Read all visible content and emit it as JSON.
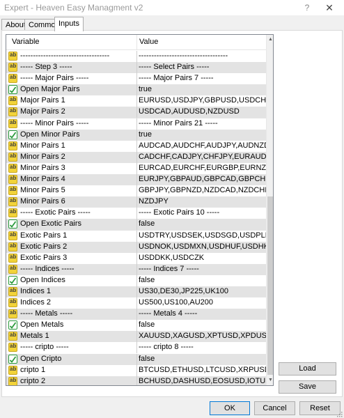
{
  "window": {
    "title": "Expert - Heaven Easy Managment v2",
    "help": "?",
    "close": "✕"
  },
  "tabs": [
    "About",
    "Common",
    "Inputs"
  ],
  "grid": {
    "col_variable": "Variable",
    "col_value": "Value",
    "rows": [
      {
        "type": "ab",
        "var": "-----------------------------------",
        "val": "-----------------------------------"
      },
      {
        "type": "ab",
        "var": "----- Step 3 -----",
        "val": "----- Select Pairs -----"
      },
      {
        "type": "ab",
        "var": "----- Major Pairs  -----",
        "val": "----- Major Pairs 7 -----"
      },
      {
        "type": "bool",
        "var": "Open Major Pairs",
        "val": "true"
      },
      {
        "type": "ab",
        "var": "Major Pairs 1",
        "val": "EURUSD,USDJPY,GBPUSD,USDCHF"
      },
      {
        "type": "ab",
        "var": "Major Pairs 2",
        "val": "USDCAD,AUDUSD,NZDUSD"
      },
      {
        "type": "ab",
        "var": "----- Minor Pairs  -----",
        "val": "----- Minor Pairs 21 -----"
      },
      {
        "type": "bool",
        "var": "Open Minor Pairs",
        "val": "true"
      },
      {
        "type": "ab",
        "var": "Minor Pairs 1",
        "val": "AUDCAD,AUDCHF,AUDJPY,AUDNZD"
      },
      {
        "type": "ab",
        "var": "Minor Pairs 2",
        "val": "CADCHF,CADJPY,CHFJPY,EURAUD"
      },
      {
        "type": "ab",
        "var": "Minor Pairs 3",
        "val": "EURCAD,EURCHF,EURGBP,EURNZD"
      },
      {
        "type": "ab",
        "var": "Minor Pairs 4",
        "val": "EURJPY,GBPAUD,GBPCAD,GBPCHF"
      },
      {
        "type": "ab",
        "var": "Minor Pairs 5",
        "val": "GBPJPY,GBPNZD,NZDCAD,NZDCHF"
      },
      {
        "type": "ab",
        "var": "Minor Pairs 6",
        "val": "NZDJPY"
      },
      {
        "type": "ab",
        "var": "----- Exotic Pairs  -----",
        "val": "----- Exotic Pairs 10 -----"
      },
      {
        "type": "bool",
        "var": "Open Exotic Pairs",
        "val": "false"
      },
      {
        "type": "ab",
        "var": "Exotic Pairs 1",
        "val": "USDTRY,USDSEK,USDSGD,USDPLN"
      },
      {
        "type": "ab",
        "var": "Exotic Pairs 2",
        "val": "USDNOK,USDMXN,USDHUF,USDHKD"
      },
      {
        "type": "ab",
        "var": "Exotic Pairs 3",
        "val": "USDDKK,USDCZK"
      },
      {
        "type": "ab",
        "var": "----- Indices  -----",
        "val": "----- Indices 7 -----"
      },
      {
        "type": "bool",
        "var": "Open Indices",
        "val": "false"
      },
      {
        "type": "ab",
        "var": "Indices 1",
        "val": "US30,DE30,JP225,UK100"
      },
      {
        "type": "ab",
        "var": "Indices 2",
        "val": "US500,US100,AU200"
      },
      {
        "type": "ab",
        "var": "----- Metals  -----",
        "val": "----- Metals 4 -----"
      },
      {
        "type": "bool",
        "var": "Open Metals",
        "val": "false"
      },
      {
        "type": "ab",
        "var": "Metals 1",
        "val": "XAUUSD,XAGUSD,XPTUSD,XPDUSD"
      },
      {
        "type": "ab",
        "var": "----- cripto  -----",
        "val": "----- cripto 8 -----"
      },
      {
        "type": "bool",
        "var": "Open Cripto",
        "val": "false"
      },
      {
        "type": "ab",
        "var": "cripto 1",
        "val": "BTCUSD,ETHUSD,LTCUSD,XRPUSD"
      },
      {
        "type": "ab",
        "var": "cripto 2",
        "val": "BCHUSD,DASHUSD,EOSUSD,IOTUSD"
      }
    ]
  },
  "buttons": {
    "load": "Load",
    "save": "Save",
    "ok": "OK",
    "cancel": "Cancel",
    "reset": "Reset"
  },
  "icons": {
    "string": "ab",
    "bool": "bool-check-icon"
  }
}
